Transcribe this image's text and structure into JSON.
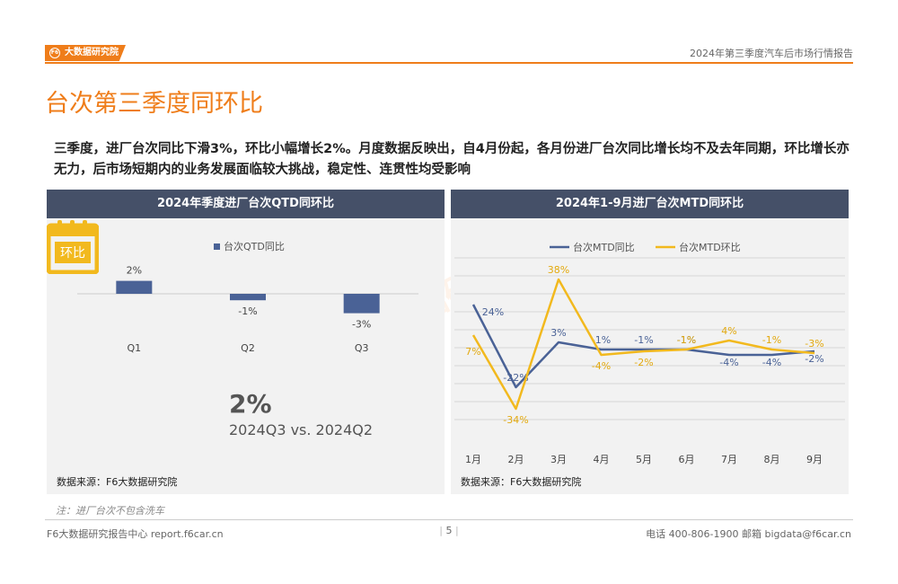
{
  "header": {
    "logo_text": "大数据研究院",
    "logo_mark": "F6",
    "report_title": "2024年第三季度汽车后市场行情报告"
  },
  "page_title": "台次第三季度同环比",
  "summary": "三季度，进厂台次同比下滑3%，环比小幅增长2%。月度数据反映出，自4月份起，各月份进厂台次同比增长均不及去年同期，环比增长亦无力，后市场短期内的业务发展面临较大挑战，稳定性、连贯性均受影响",
  "left_panel": {
    "title": "2024年季度进厂台次QTD同环比",
    "big_value": "2%",
    "calendar_label": "环比",
    "compare_text": "2024Q3 vs. 2024Q2",
    "source": "数据来源：F6大数据研究院"
  },
  "right_panel": {
    "title": "2024年1-9月进厂台次MTD同环比",
    "source": "数据来源：F6大数据研究院"
  },
  "watermark": "大数据研究院",
  "note": "注：进厂台次不包含洗车",
  "footer": {
    "left": "F6大数据研究报告中心 report.f6car.cn",
    "page": "5",
    "right": "电话 400-806-1900  邮箱 bigdata@f6car.cn"
  },
  "colors": {
    "accent": "#ef7d1a",
    "navy_bar": "#4a6296",
    "yellow_line": "#f2b91e",
    "panel_head": "#455068"
  },
  "chart_data": [
    {
      "type": "bar",
      "legend": "台次QTD同比",
      "categories": [
        "Q1",
        "Q2",
        "Q3"
      ],
      "values": [
        2,
        -1,
        -3
      ],
      "labels": [
        "2%",
        "-1%",
        "-3%"
      ],
      "ylim": [
        -4,
        3
      ]
    },
    {
      "type": "line",
      "categories": [
        "1月",
        "2月",
        "3月",
        "4月",
        "5月",
        "6月",
        "7月",
        "8月",
        "9月"
      ],
      "series": [
        {
          "name": "台次MTD同比",
          "color": "#4a6296",
          "values": [
            24,
            -22,
            3,
            -1,
            -1,
            -1,
            -4,
            -4,
            -2
          ],
          "labels": [
            "24%",
            "-22%",
            "3%",
            "-1%",
            "-1%",
            "-1%",
            "-4%",
            "-4%",
            "-2%"
          ]
        },
        {
          "name": "台次MTD环比",
          "color": "#f2b91e",
          "values": [
            7,
            -34,
            38,
            -4,
            -2,
            -1,
            4,
            -1,
            -3
          ],
          "labels": [
            "7%",
            "-34%",
            "38%",
            "-4%",
            "-2%",
            "-1%",
            "4%",
            "-1%",
            "-3%"
          ]
        }
      ],
      "ylim": [
        -40,
        50
      ],
      "grid": true
    }
  ]
}
